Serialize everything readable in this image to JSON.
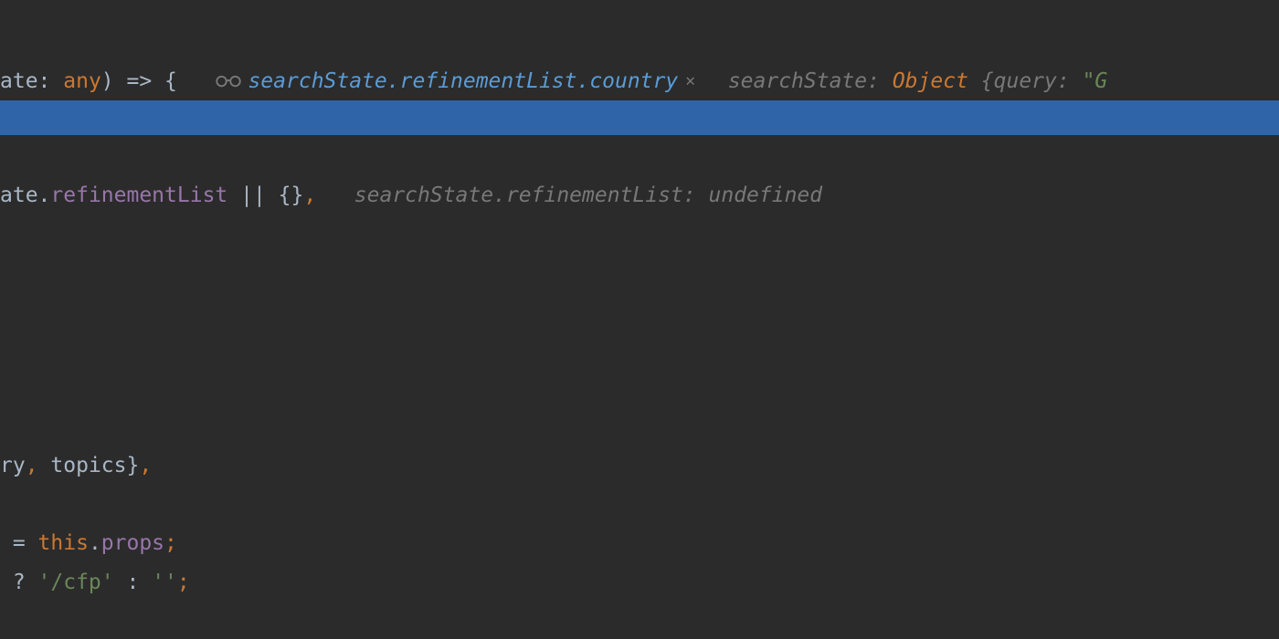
{
  "line1": {
    "code": {
      "t1": "ate",
      "colon": ": ",
      "any": "any",
      "paren": ")",
      "arrow": " => ",
      "brace": "{",
      "spaces": "   "
    },
    "watch": {
      "expr": "searchState.refinementList.country"
    },
    "inlay": {
      "label": "searchState: ",
      "type": "Object ",
      "brace": "{",
      "key": "query: ",
      "val": "\"G"
    }
  },
  "line3": {
    "code": {
      "t1": "ate",
      "dot": ".",
      "prop": "refinementList",
      "rest": " || {}",
      "comma": ",",
      "spaces": "   "
    },
    "inlay": {
      "text": "searchState.refinementList: undefined"
    }
  },
  "line4": {
    "t1": "ry",
    "comma1": ", ",
    "t2": "topics}",
    "comma2": ","
  },
  "line5": {
    "eq": " = ",
    "this": "this",
    "dot": ".",
    "props": "props",
    "semi": ";"
  },
  "line6": {
    "q": " ? ",
    "str1": "'/cfp'",
    "colon": " : ",
    "str2": "''",
    "semi": ";"
  }
}
